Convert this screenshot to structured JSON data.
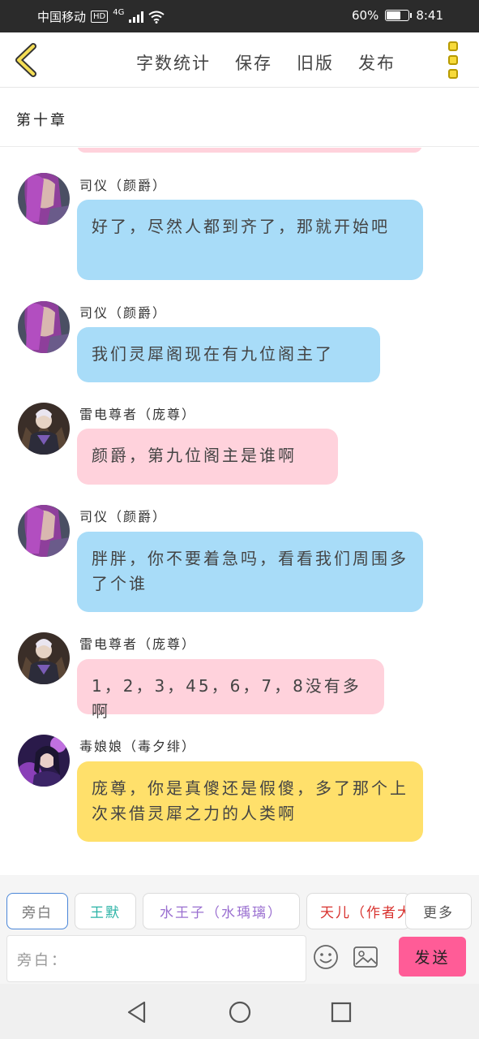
{
  "status_bar": {
    "carrier": "中国移动",
    "hd": "HD",
    "network": "4G",
    "battery_pct": "60%",
    "time": "8:41"
  },
  "toolbar": {
    "word_count": "字数统计",
    "save": "保存",
    "old_version": "旧版",
    "publish": "发布"
  },
  "chapter": {
    "title": "第十章"
  },
  "messages": [
    {
      "name": "司仪（颜爵）",
      "text": "好了，尽然人都到齐了，那就开始吧",
      "color": "#a8dcf8"
    },
    {
      "name": "司仪（颜爵）",
      "text": "我们灵犀阁现在有九位阁主了",
      "color": "#a8dcf8"
    },
    {
      "name": "雷电尊者（庞尊）",
      "text": "颜爵，第九位阁主是谁啊",
      "color": "#ffd2dc"
    },
    {
      "name": "司仪（颜爵）",
      "text": "胖胖，你不要着急吗，看看我们周围多了个谁",
      "color": "#a8dcf8"
    },
    {
      "name": "雷电尊者（庞尊）",
      "text": "1，2，3，45，6，7，8没有多啊",
      "color": "#ffd2dc"
    },
    {
      "name": "毒娘娘（毒夕绯）",
      "text": "庞尊，你是真傻还是假傻，多了那个上次来借灵犀之力的人类啊",
      "color": "#ffe06b"
    }
  ],
  "roles": [
    {
      "label": "旁白",
      "color": "#777777"
    },
    {
      "label": "王默",
      "color": "#2bb3a6"
    },
    {
      "label": "水王子（水瑀璃）",
      "color": "#9a6fd0"
    },
    {
      "label": "天儿（作者大",
      "color": "#d8322e"
    },
    {
      "label": "更多",
      "color": "#555555"
    }
  ],
  "composer": {
    "placeholder": "旁白：",
    "send": "发送"
  }
}
